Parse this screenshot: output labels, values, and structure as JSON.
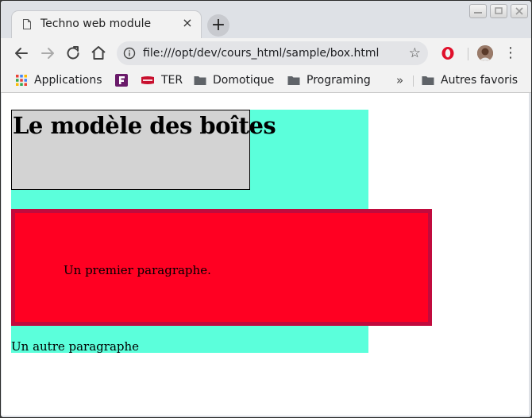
{
  "browser": {
    "tab": {
      "title": "Techno web module",
      "close": "×"
    },
    "new_tab": "+",
    "address": {
      "url": "file:///opt/dev/cours_html/sample/box.html",
      "star": "☆"
    },
    "menu": "⋮"
  },
  "bookmarks": {
    "items": [
      {
        "label": "Applications",
        "icon": "apps-grid-icon"
      },
      {
        "label": "",
        "icon": "fav-logo-icon"
      },
      {
        "label": "TER",
        "icon": "sncf-icon"
      },
      {
        "label": "Domotique",
        "icon": "folder-icon"
      },
      {
        "label": "Programing",
        "icon": "folder-icon"
      }
    ],
    "overflow": "»",
    "other": "Autres favoris"
  },
  "page": {
    "heading": "Le modèle des boîtes",
    "paragraph1": "Un premier paragraphe.",
    "paragraph2": "Un autre paragraphe"
  },
  "colors": {
    "outer_box": "#5bffdb",
    "heading_box": "#d3d3d3",
    "red_box": "#ff0022",
    "red_border": "#c10a3d"
  }
}
